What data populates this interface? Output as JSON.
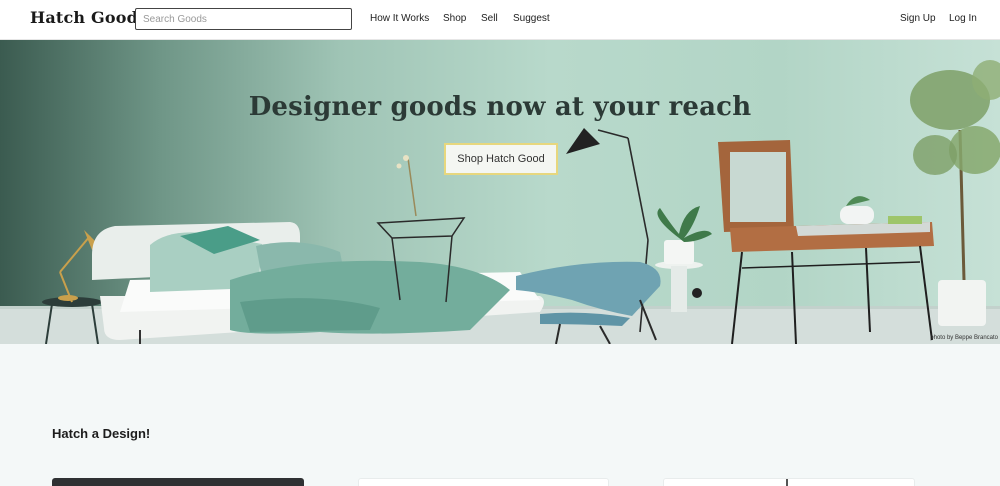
{
  "header": {
    "logo": "Hatch Good",
    "search_placeholder": "Search Goods",
    "nav": [
      "How It Works",
      "Shop",
      "Sell",
      "Suggest"
    ],
    "auth": [
      "Sign Up",
      "Log In"
    ]
  },
  "hero": {
    "title": "Designer goods now at your reach",
    "button_label": "Shop Hatch Good",
    "photo_credit": "photo by Beppe Brancato"
  },
  "section": {
    "title": "Hatch a Design!"
  },
  "colors": {
    "accent_border": "#e7d77e",
    "page_bg": "#f4f8f8"
  }
}
